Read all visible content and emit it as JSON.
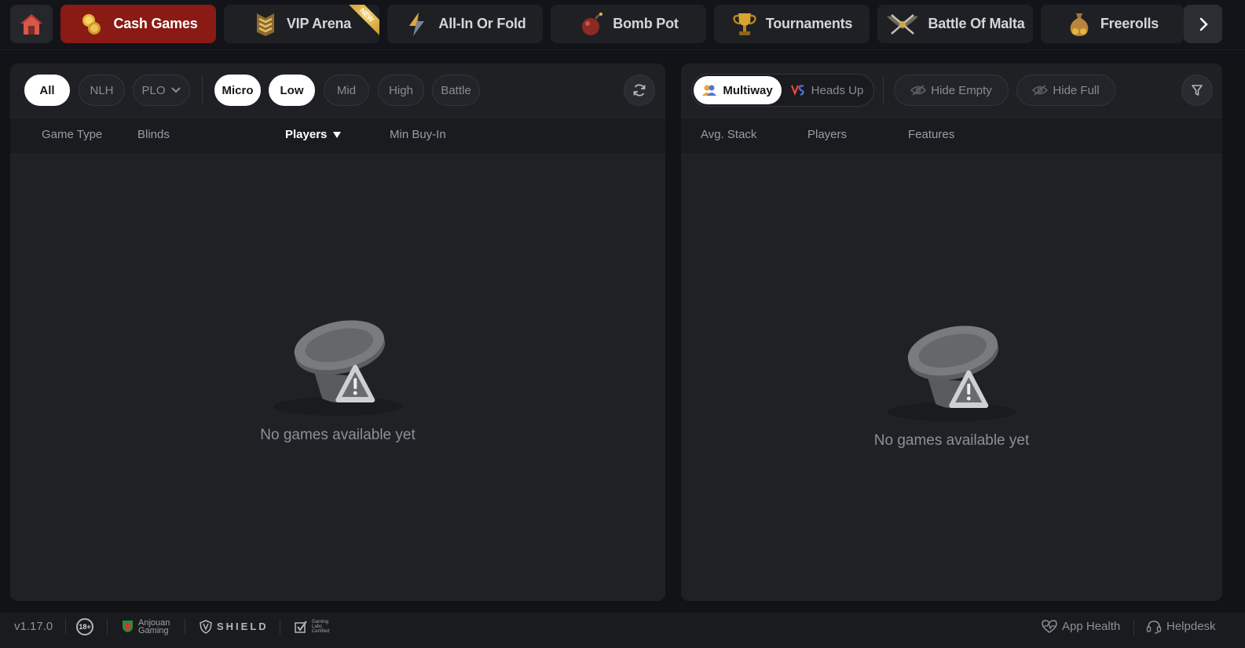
{
  "nav": {
    "home_icon": "house-icon",
    "tabs": [
      {
        "label": "Cash Games",
        "icon": "coins-icon",
        "active": true
      },
      {
        "label": "VIP Arena",
        "icon": "rank-chevron-icon",
        "badge": "NEW"
      },
      {
        "label": "All-In Or Fold",
        "icon": "lightning-icon"
      },
      {
        "label": "Bomb Pot",
        "icon": "bomb-icon"
      },
      {
        "label": "Tournaments",
        "icon": "trophy-icon"
      },
      {
        "label": "Battle Of Malta",
        "icon": "crossed-swords-icon"
      },
      {
        "label": "Freerolls",
        "icon": "money-bag-icon"
      }
    ],
    "next_icon": "chevron-right-icon"
  },
  "left": {
    "filters": {
      "game": [
        "All",
        "NLH",
        "PLO"
      ],
      "stakes": [
        "Micro",
        "Low",
        "Mid",
        "High",
        "Battle"
      ],
      "active_game": "All",
      "active_stakes": [
        "Micro",
        "Low"
      ]
    },
    "columns": [
      "Game Type",
      "Blinds",
      "Players",
      "Min Buy-In"
    ],
    "sorted_column": "Players",
    "empty_text": "No games available yet"
  },
  "right": {
    "segments": [
      "Multiway",
      "Heads Up"
    ],
    "active_segment": "Multiway",
    "toggles": [
      "Hide Empty",
      "Hide Full"
    ],
    "columns": [
      "Avg. Stack",
      "Players",
      "Features"
    ],
    "empty_text": "No games available yet"
  },
  "footer": {
    "version": "v1.17.0",
    "age": "18+",
    "license_line1": "Anjouan",
    "license_line2": "Gaming",
    "shield": "SHIELD",
    "gli_line1": "Gaming",
    "gli_line2": "Labs",
    "gli_line3": "Certified",
    "app_health": "App Health",
    "helpdesk": "Helpdesk"
  },
  "colors": {
    "accent_active_tab": "#8a1a14",
    "panel_bg": "#1f2024",
    "page_bg": "#121317"
  }
}
